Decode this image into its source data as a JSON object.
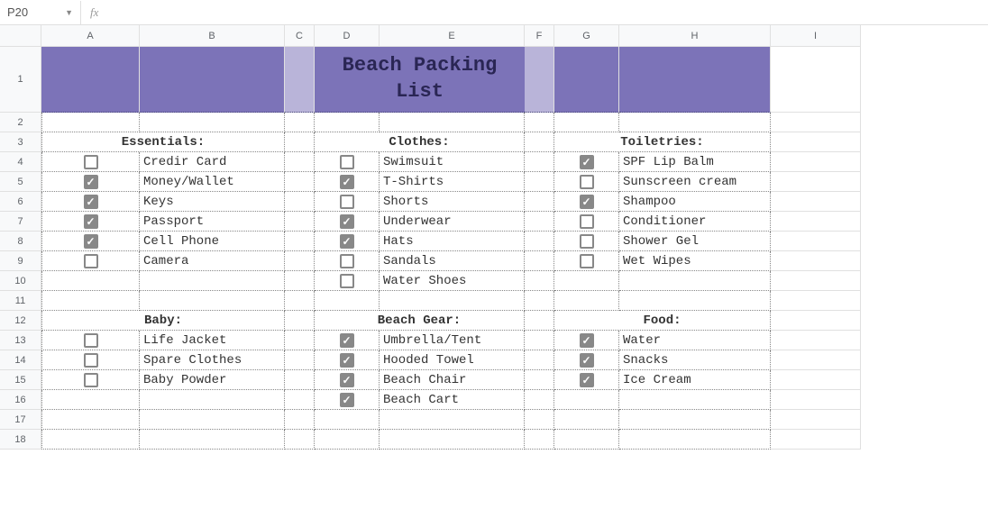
{
  "nameBox": "P20",
  "fxLabel": "fx",
  "formula": "",
  "columns": [
    "A",
    "B",
    "C",
    "D",
    "E",
    "F",
    "G",
    "H",
    "I"
  ],
  "rows": [
    "1",
    "2",
    "3",
    "4",
    "5",
    "6",
    "7",
    "8",
    "9",
    "10",
    "11",
    "12",
    "13",
    "14",
    "15",
    "16",
    "17",
    "18"
  ],
  "title": "Beach Packing List",
  "sections": {
    "essentials": {
      "heading": "Essentials:",
      "items": [
        {
          "checked": false,
          "label": "Credir Card"
        },
        {
          "checked": true,
          "label": "Money/Wallet"
        },
        {
          "checked": true,
          "label": "Keys"
        },
        {
          "checked": true,
          "label": "Passport"
        },
        {
          "checked": true,
          "label": "Cell Phone"
        },
        {
          "checked": false,
          "label": "Camera"
        }
      ]
    },
    "clothes": {
      "heading": "Clothes:",
      "items": [
        {
          "checked": false,
          "label": "Swimsuit"
        },
        {
          "checked": true,
          "label": "T-Shirts"
        },
        {
          "checked": false,
          "label": "Shorts"
        },
        {
          "checked": true,
          "label": "Underwear"
        },
        {
          "checked": true,
          "label": "Hats"
        },
        {
          "checked": false,
          "label": "Sandals"
        },
        {
          "checked": false,
          "label": "Water Shoes"
        }
      ]
    },
    "toiletries": {
      "heading": "Toiletries:",
      "items": [
        {
          "checked": true,
          "label": "SPF Lip Balm"
        },
        {
          "checked": false,
          "label": "Sunscreen cream"
        },
        {
          "checked": true,
          "label": "Shampoo"
        },
        {
          "checked": false,
          "label": "Conditioner"
        },
        {
          "checked": false,
          "label": "Shower Gel"
        },
        {
          "checked": false,
          "label": "Wet Wipes"
        }
      ]
    },
    "baby": {
      "heading": "Baby:",
      "items": [
        {
          "checked": false,
          "label": "Life Jacket"
        },
        {
          "checked": false,
          "label": "Spare Clothes"
        },
        {
          "checked": false,
          "label": "Baby Powder"
        }
      ]
    },
    "beachGear": {
      "heading": "Beach Gear:",
      "items": [
        {
          "checked": true,
          "label": "Umbrella/Tent"
        },
        {
          "checked": true,
          "label": "Hooded Towel"
        },
        {
          "checked": true,
          "label": "Beach Chair"
        },
        {
          "checked": true,
          "label": "Beach Cart"
        }
      ]
    },
    "food": {
      "heading": "Food:",
      "items": [
        {
          "checked": true,
          "label": "Water"
        },
        {
          "checked": true,
          "label": "Snacks"
        },
        {
          "checked": true,
          "label": "Ice Cream"
        }
      ]
    }
  }
}
